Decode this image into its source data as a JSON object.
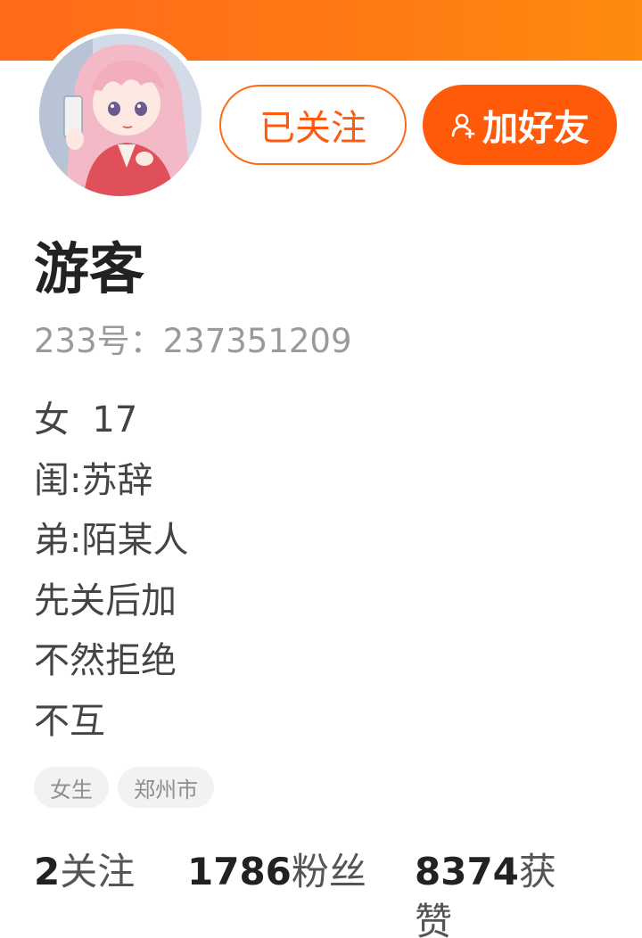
{
  "profile": {
    "nickname": "游客",
    "uid": "233号：237351209",
    "bio_lines": [
      "女  17",
      "闺:苏辞",
      "弟:陌某人",
      "先关后加",
      "不然拒绝",
      "不互"
    ],
    "tags": [
      "女生",
      "郑州市"
    ]
  },
  "actions": {
    "follow_label": "已关注",
    "add_friend_label": "加好友",
    "add_friend_icon": "add-user-icon"
  },
  "stats": {
    "following": {
      "value": "2",
      "label": "关注"
    },
    "fans": {
      "value": "1786",
      "label": "粉丝"
    },
    "likes": {
      "value": "8374",
      "label": "获赞"
    }
  },
  "colors": {
    "accent": "#ff5a0a",
    "header": "#ff6a1a",
    "text_primary": "#222222",
    "text_muted": "#9a9a9a"
  }
}
